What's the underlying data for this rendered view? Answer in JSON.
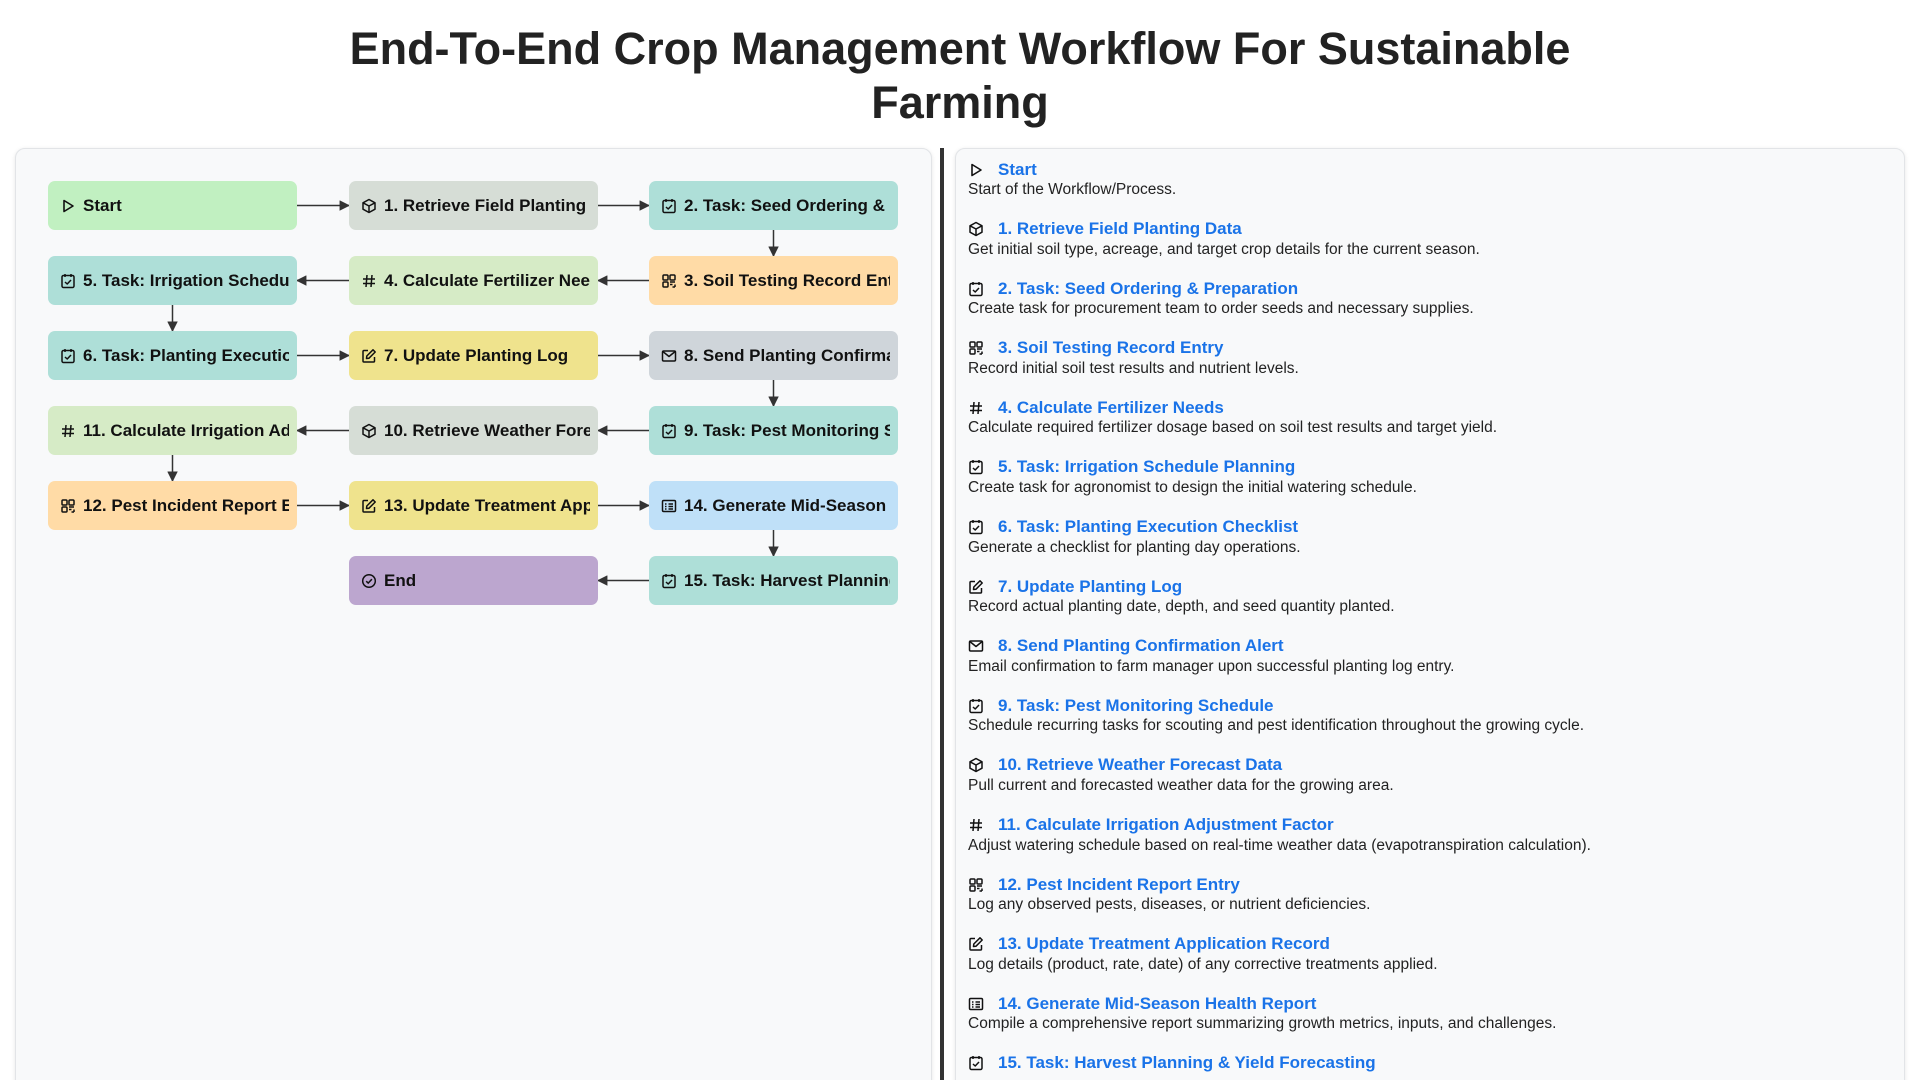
{
  "page": {
    "title_line1": "End-To-End Crop Management Workflow For Sustainable",
    "title_line2": "Farming"
  },
  "colors": {
    "start": "#c1f0c1",
    "retrieve": "#d6ddd6",
    "task": "#aedfd8",
    "entry": "#ffdba6",
    "calculate": "#d6ebc6",
    "update": "#efe38d",
    "alert": "#cfd5da",
    "report": "#bfe0f8",
    "end": "#bca6cf",
    "link": "#1a73e8"
  },
  "diagram": {
    "nodes": [
      {
        "id": "start",
        "label": "Start",
        "icon": "play-icon",
        "type": "start"
      },
      {
        "id": "n1",
        "label": "1. Retrieve Field Planting D",
        "icon": "cube-icon",
        "type": "retrieve"
      },
      {
        "id": "n2",
        "label": "2. Task: Seed Ordering & P",
        "icon": "checkbox-icon",
        "type": "task"
      },
      {
        "id": "n3",
        "label": "3. Soil Testing Record Entr",
        "icon": "grid-icon",
        "type": "entry"
      },
      {
        "id": "n4",
        "label": "4. Calculate Fertilizer Need",
        "icon": "hash-icon",
        "type": "calculate"
      },
      {
        "id": "n5",
        "label": "5. Task: Irrigation Schedule",
        "icon": "checkbox-icon",
        "type": "task"
      },
      {
        "id": "n6",
        "label": "6. Task: Planting Execution",
        "icon": "checkbox-icon",
        "type": "task"
      },
      {
        "id": "n7",
        "label": "7. Update Planting Log",
        "icon": "edit-icon",
        "type": "update"
      },
      {
        "id": "n8",
        "label": "8. Send Planting Confirmat",
        "icon": "mail-icon",
        "type": "alert"
      },
      {
        "id": "n9",
        "label": "9. Task: Pest Monitoring Sc",
        "icon": "checkbox-icon",
        "type": "task"
      },
      {
        "id": "n10",
        "label": "10. Retrieve Weather Forec",
        "icon": "cube-icon",
        "type": "retrieve"
      },
      {
        "id": "n11",
        "label": "11. Calculate Irrigation Adju",
        "icon": "hash-icon",
        "type": "calculate"
      },
      {
        "id": "n12",
        "label": "12. Pest Incident Report En",
        "icon": "grid-icon",
        "type": "entry"
      },
      {
        "id": "n13",
        "label": "13. Update Treatment Appli",
        "icon": "edit-icon",
        "type": "update"
      },
      {
        "id": "n14",
        "label": "14. Generate Mid-Season H",
        "icon": "report-icon",
        "type": "report"
      },
      {
        "id": "n15",
        "label": "15. Task: Harvest Planning",
        "icon": "checkbox-icon",
        "type": "task"
      },
      {
        "id": "end",
        "label": "End",
        "icon": "check-circle-icon",
        "type": "end"
      }
    ],
    "edges": [
      [
        "start",
        "n1"
      ],
      [
        "n1",
        "n2"
      ],
      [
        "n2",
        "n3"
      ],
      [
        "n3",
        "n4"
      ],
      [
        "n4",
        "n5"
      ],
      [
        "n5",
        "n6"
      ],
      [
        "n6",
        "n7"
      ],
      [
        "n7",
        "n8"
      ],
      [
        "n8",
        "n9"
      ],
      [
        "n9",
        "n10"
      ],
      [
        "n10",
        "n11"
      ],
      [
        "n11",
        "n12"
      ],
      [
        "n12",
        "n13"
      ],
      [
        "n13",
        "n14"
      ],
      [
        "n14",
        "n15"
      ],
      [
        "n15",
        "end"
      ]
    ]
  },
  "steps": [
    {
      "title": "Start",
      "desc": "Start of the Workflow/Process.",
      "icon": "play-icon"
    },
    {
      "title": "1. Retrieve Field Planting Data",
      "desc": "Get initial soil type, acreage, and target crop details for the current season.",
      "icon": "cube-icon"
    },
    {
      "title": "2. Task: Seed Ordering & Preparation",
      "desc": "Create task for procurement team to order seeds and necessary supplies.",
      "icon": "checkbox-icon"
    },
    {
      "title": "3. Soil Testing Record Entry",
      "desc": "Record initial soil test results and nutrient levels.",
      "icon": "grid-icon"
    },
    {
      "title": "4. Calculate Fertilizer Needs",
      "desc": "Calculate required fertilizer dosage based on soil test results and target yield.",
      "icon": "hash-icon"
    },
    {
      "title": "5. Task: Irrigation Schedule Planning",
      "desc": "Create task for agronomist to design the initial watering schedule.",
      "icon": "checkbox-icon"
    },
    {
      "title": "6. Task: Planting Execution Checklist",
      "desc": "Generate a checklist for planting day operations.",
      "icon": "checkbox-icon"
    },
    {
      "title": "7. Update Planting Log",
      "desc": "Record actual planting date, depth, and seed quantity planted.",
      "icon": "edit-icon"
    },
    {
      "title": "8. Send Planting Confirmation Alert",
      "desc": "Email confirmation to farm manager upon successful planting log entry.",
      "icon": "mail-icon"
    },
    {
      "title": "9. Task: Pest Monitoring Schedule",
      "desc": "Schedule recurring tasks for scouting and pest identification throughout the growing cycle.",
      "icon": "checkbox-icon"
    },
    {
      "title": "10. Retrieve Weather Forecast Data",
      "desc": "Pull current and forecasted weather data for the growing area.",
      "icon": "cube-icon"
    },
    {
      "title": "11. Calculate Irrigation Adjustment Factor",
      "desc": "Adjust watering schedule based on real-time weather data (evapotranspiration calculation).",
      "icon": "hash-icon"
    },
    {
      "title": "12. Pest Incident Report Entry",
      "desc": "Log any observed pests, diseases, or nutrient deficiencies.",
      "icon": "grid-icon"
    },
    {
      "title": "13. Update Treatment Application Record",
      "desc": "Log details (product, rate, date) of any corrective treatments applied.",
      "icon": "edit-icon"
    },
    {
      "title": "14. Generate Mid-Season Health Report",
      "desc": "Compile a comprehensive report summarizing growth metrics, inputs, and challenges.",
      "icon": "report-icon"
    },
    {
      "title": "15. Task: Harvest Planning & Yield Forecasting",
      "desc": "",
      "icon": "checkbox-icon"
    }
  ]
}
